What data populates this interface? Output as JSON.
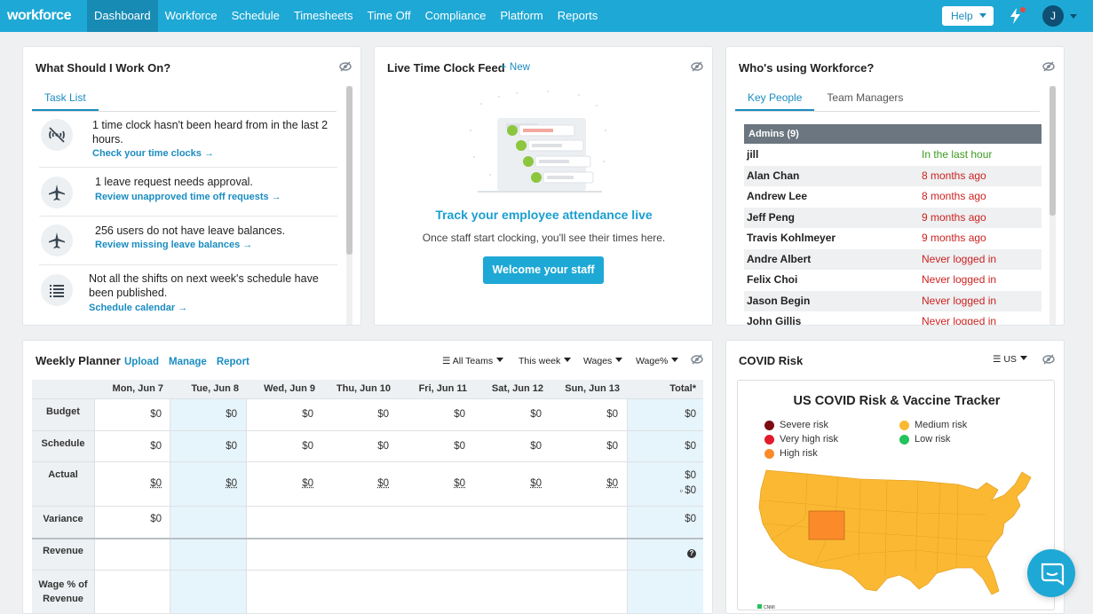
{
  "nav": {
    "logo": "workforce",
    "items": [
      "Dashboard",
      "Workforce",
      "Schedule",
      "Timesheets",
      "Time Off",
      "Compliance",
      "Platform",
      "Reports"
    ],
    "help": "Help",
    "avatar_initial": "J"
  },
  "work_on": {
    "title": "What Should I Work On?",
    "tab": "Task List",
    "tasks": [
      {
        "icon": "signal-off-icon",
        "text": "1 time clock hasn't been heard from in the last 2 hours.",
        "link": "Check your time clocks"
      },
      {
        "icon": "airplane-icon",
        "text": "1 leave request needs approval.",
        "link": "Review unapproved time off requests"
      },
      {
        "icon": "airplane-icon",
        "text": "256 users do not have leave balances.",
        "link": "Review missing leave balances"
      },
      {
        "icon": "list-icon",
        "text": "Not all the shifts on next week's schedule have been published.",
        "link": "Schedule calendar"
      }
    ]
  },
  "live_feed": {
    "title": "Live Time Clock Feed",
    "new_label": "New",
    "heading": "Track your employee attendance live",
    "subtext": "Once staff start clocking, you'll see their times here.",
    "button": "Welcome your staff"
  },
  "whos_using": {
    "title": "Who's using Workforce?",
    "tabs": [
      "Key People",
      "Team Managers"
    ],
    "group": "Admins (9)",
    "people": [
      {
        "name": "jill",
        "last": "In the last hour",
        "status": "recent"
      },
      {
        "name": "Alan Chan",
        "last": "8 months ago",
        "status": "old"
      },
      {
        "name": "Andrew Lee",
        "last": "8 months ago",
        "status": "old"
      },
      {
        "name": "Jeff Peng",
        "last": "9 months ago",
        "status": "old"
      },
      {
        "name": "Travis Kohlmeyer",
        "last": "9 months ago",
        "status": "old"
      },
      {
        "name": "Andre Albert",
        "last": "Never logged in",
        "status": "never"
      },
      {
        "name": "Felix Choi",
        "last": "Never logged in",
        "status": "never"
      },
      {
        "name": "Jason Begin",
        "last": "Never logged in",
        "status": "never"
      },
      {
        "name": "John Gillis",
        "last": "Never logged in",
        "status": "never"
      }
    ]
  },
  "planner": {
    "title": "Weekly Planner",
    "links": [
      "Upload",
      "Manage",
      "Report"
    ],
    "filters": [
      "All Teams",
      "This week",
      "Wages",
      "Wage%"
    ],
    "days": [
      "Mon, Jun 7",
      "Tue, Jun 8",
      "Wed, Jun 9",
      "Thu, Jun 10",
      "Fri, Jun 11",
      "Sat, Jun 12",
      "Sun, Jun 13"
    ],
    "total_label": "Total*",
    "rows": {
      "budget": {
        "label": "Budget",
        "values": [
          "$0",
          "$0",
          "$0",
          "$0",
          "$0",
          "$0",
          "$0"
        ],
        "total": "$0"
      },
      "schedule": {
        "label": "Schedule",
        "values": [
          "$0",
          "$0",
          "$0",
          "$0",
          "$0",
          "$0",
          "$0"
        ],
        "total": "$0"
      },
      "actual": {
        "label": "Actual",
        "values": [
          "$0",
          "$0",
          "$0",
          "$0",
          "$0",
          "$0",
          "$0"
        ],
        "total": "$0",
        "total2": "$0"
      },
      "variance": {
        "label": "Variance",
        "first": "$0",
        "total": "$0"
      },
      "revenue": {
        "label": "Revenue"
      },
      "wage_pct": {
        "label": "Wage % of Revenue"
      }
    }
  },
  "covid": {
    "title": "COVID Risk",
    "filter": "US",
    "chart_title": "US COVID Risk & Vaccine Tracker",
    "legend": [
      {
        "label": "Severe risk",
        "color": "#7b0c14"
      },
      {
        "label": "Medium risk",
        "color": "#fbb933"
      },
      {
        "label": "Very high risk",
        "color": "#e21b2c"
      },
      {
        "label": "Low risk",
        "color": "#22c35a"
      },
      {
        "label": "High risk",
        "color": "#fb8a2a"
      }
    ],
    "map_note": "CNMI"
  },
  "colors": {
    "accent": "#1ea8d5",
    "recent": "#3d9a1e",
    "alert": "#cc2222"
  }
}
